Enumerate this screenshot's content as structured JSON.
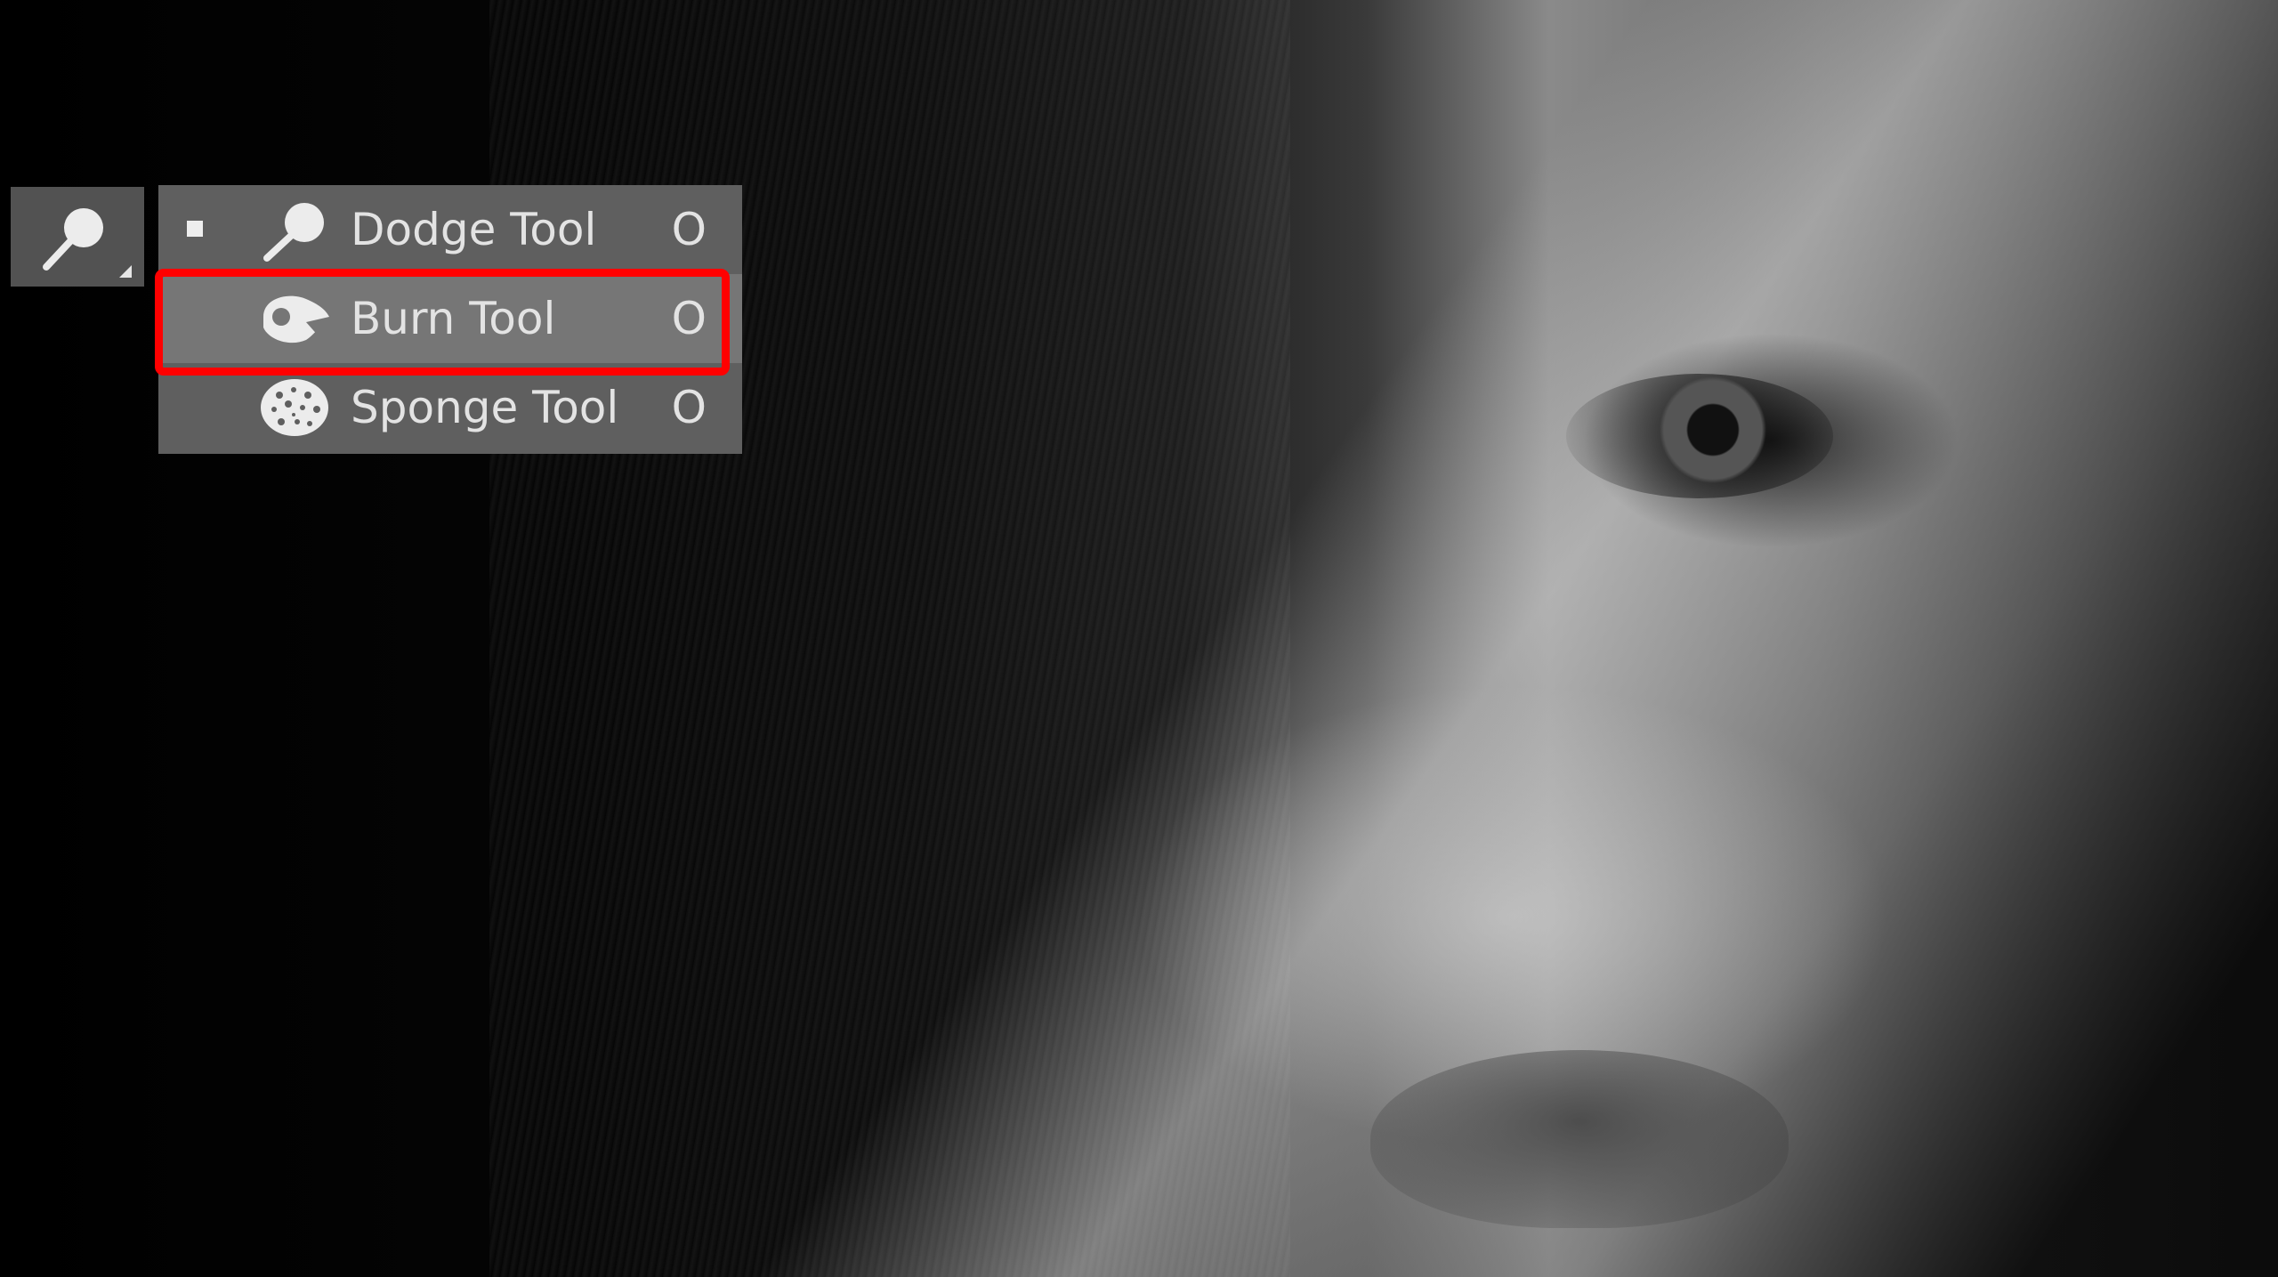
{
  "canvas": {
    "background_image": "black-and-white portrait photo"
  },
  "toolbox": {
    "active_tool_icon": "dodge-icon"
  },
  "tool_flyout": {
    "items": [
      {
        "label": "Dodge Tool",
        "shortcut": "O",
        "icon": "dodge-icon",
        "selected": true
      },
      {
        "label": "Burn Tool",
        "shortcut": "O",
        "icon": "burn-icon",
        "selected": false,
        "highlighted": true
      },
      {
        "label": "Sponge Tool",
        "shortcut": "O",
        "icon": "sponge-icon",
        "selected": false
      }
    ]
  },
  "colors": {
    "highlight_box": "#ff0000",
    "menu_background": "#5f5f5f",
    "menu_hover": "#767676",
    "menu_text": "#e3e3e3"
  }
}
